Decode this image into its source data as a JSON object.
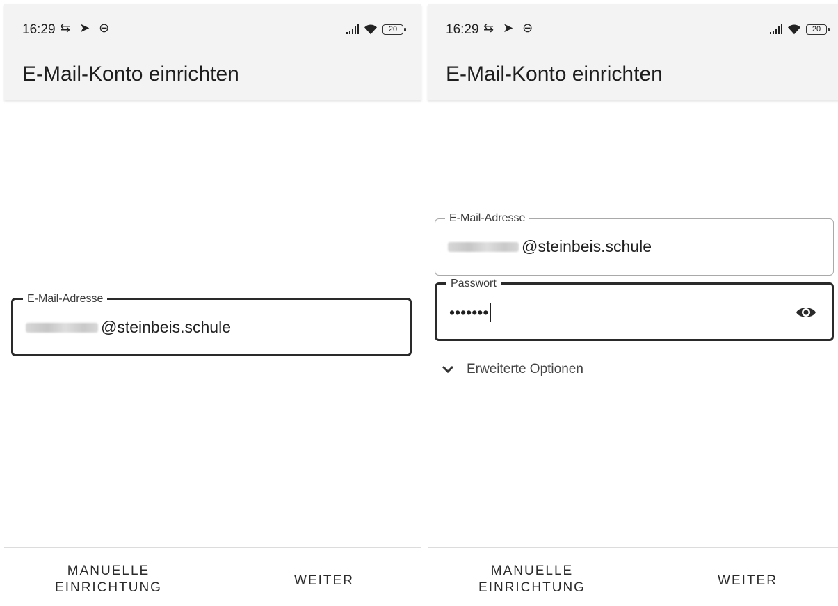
{
  "status": {
    "time": "16:29",
    "icons": "⇆ ➤ ⊖",
    "battery": "20"
  },
  "appbar": {
    "title": "E-Mail-Konto einrichten"
  },
  "left": {
    "email": {
      "label": "E-Mail-Adresse",
      "value_domain": "@steinbeis.schule"
    }
  },
  "right": {
    "email": {
      "label": "E-Mail-Adresse",
      "value_domain": "@steinbeis.schule"
    },
    "password": {
      "label": "Passwort",
      "value": "•••••••"
    },
    "advanced_options": "Erweiterte Optionen"
  },
  "buttons": {
    "manual_line1": "MANUELLE",
    "manual_line2": "EINRICHTUNG",
    "next": "WEITER"
  },
  "icons": {
    "visibility": "eye-icon",
    "expand": "chevron-down-icon"
  }
}
